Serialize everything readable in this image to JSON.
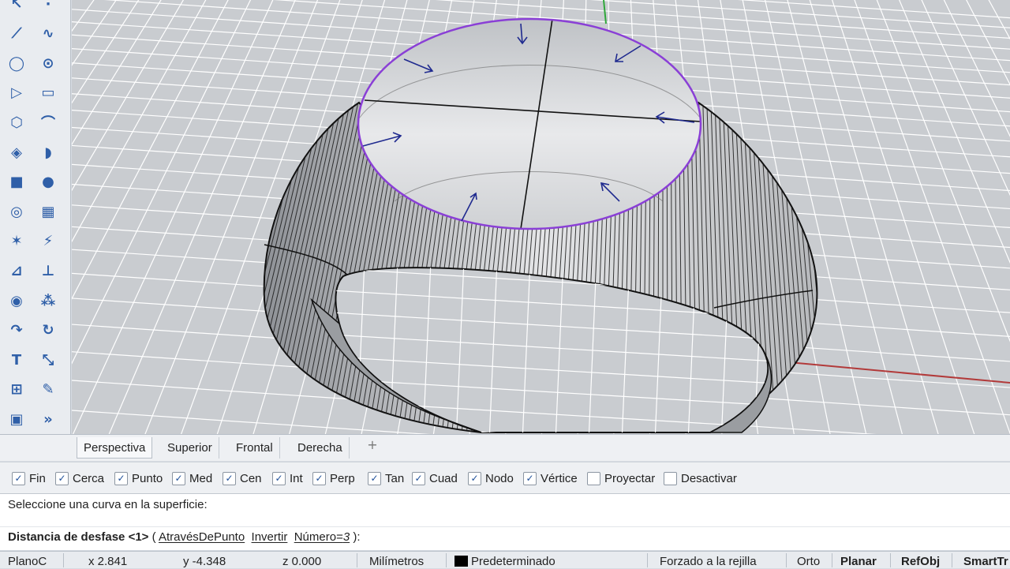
{
  "toolbar": {
    "tools": [
      {
        "name": "select-icon",
        "glyph": "↖"
      },
      {
        "name": "point-icon",
        "glyph": "·"
      },
      {
        "name": "polyline-icon",
        "glyph": "⟋"
      },
      {
        "name": "curve-icon",
        "glyph": "∿"
      },
      {
        "name": "circle-icon",
        "glyph": "◯"
      },
      {
        "name": "ellipse-icon",
        "glyph": "⊙"
      },
      {
        "name": "polygon-icon",
        "glyph": "▷"
      },
      {
        "name": "rectangle-icon",
        "glyph": "▭"
      },
      {
        "name": "hexagon-icon",
        "glyph": "⬡"
      },
      {
        "name": "fillet-curve-icon",
        "glyph": "⌒"
      },
      {
        "name": "surface-icon",
        "glyph": "◈"
      },
      {
        "name": "sweep-icon",
        "glyph": "◗"
      },
      {
        "name": "box-solid-icon",
        "glyph": "■"
      },
      {
        "name": "boolean-union-icon",
        "glyph": "●"
      },
      {
        "name": "cylinder-icon",
        "glyph": "◎"
      },
      {
        "name": "mesh-icon",
        "glyph": "▦"
      },
      {
        "name": "transform-icon",
        "glyph": "✶"
      },
      {
        "name": "analyze-icon",
        "glyph": "⚡"
      },
      {
        "name": "extend-icon",
        "glyph": "⊿"
      },
      {
        "name": "trim-icon",
        "glyph": "⊥"
      },
      {
        "name": "render-icon",
        "glyph": "◉"
      },
      {
        "name": "materials-icon",
        "glyph": "⁂"
      },
      {
        "name": "rotate-icon",
        "glyph": "↷"
      },
      {
        "name": "rotate3d-icon",
        "glyph": "↻"
      },
      {
        "name": "text-icon",
        "glyph": "T"
      },
      {
        "name": "scale-icon",
        "glyph": "⤡"
      },
      {
        "name": "array-icon",
        "glyph": "⊞"
      },
      {
        "name": "edit-icon",
        "glyph": "✎"
      },
      {
        "name": "solid-tools-icon",
        "glyph": "▣"
      },
      {
        "name": "more-tools-icon",
        "glyph": "»"
      }
    ]
  },
  "viewport_tabs": {
    "tabs": [
      "Perspectiva",
      "Superior",
      "Frontal",
      "Derecha"
    ],
    "add": "+"
  },
  "osnap": {
    "items": [
      {
        "label": "Fin",
        "checked": true
      },
      {
        "label": "Cerca",
        "checked": true
      },
      {
        "label": "Punto",
        "checked": true
      },
      {
        "label": "Med",
        "checked": true
      },
      {
        "label": "Cen",
        "checked": true
      },
      {
        "label": "Int",
        "checked": true
      },
      {
        "label": "Perp",
        "checked": true
      },
      {
        "label": "Tan",
        "checked": true
      },
      {
        "label": "Cuad",
        "checked": true
      },
      {
        "label": "Nodo",
        "checked": true
      },
      {
        "label": "Vértice",
        "checked": true
      },
      {
        "label": "Proyectar",
        "checked": false
      },
      {
        "label": "Desactivar",
        "checked": false
      }
    ],
    "check_mark": "✓"
  },
  "command": {
    "history": "Seleccione una curva en la superficie:",
    "prompt_bold": "Distancia de desfase <1>",
    "paren_open": " ( ",
    "opt1": "AtravésDePunto",
    "opt2": "Invertir",
    "opt3_name": "Número=",
    "opt3_value": "3",
    "paren_close": " ):"
  },
  "status": {
    "cplane": "PlanoC",
    "x": "x 2.841",
    "y": "y -4.348",
    "z": "z 0.000",
    "units": "Milímetros",
    "layer": "Predeterminado",
    "grid_snap": "Forzado a la rejilla",
    "ortho": "Orto",
    "planar": "Planar",
    "osnap": "RefObj",
    "smarttrack": "SmartTr"
  },
  "colors": {
    "curve": "#8a3fd6",
    "arrows": "#1f2a8f",
    "x_axis": "#b23a3a",
    "y_axis": "#2fa83a",
    "grid": "#ffffff",
    "background": "#c9ccd0"
  }
}
